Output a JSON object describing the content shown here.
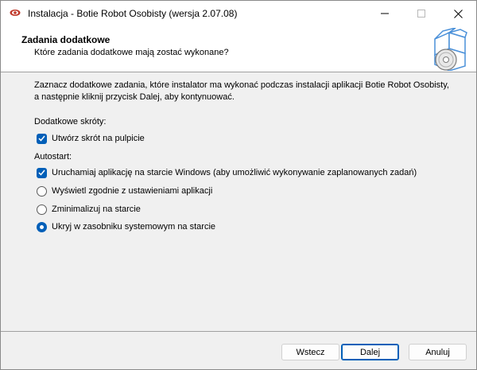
{
  "window": {
    "title": "Instalacja - Botie Robot Osobisty (wersja 2.07.08)"
  },
  "header": {
    "title": "Zadania dodatkowe",
    "subtitle": "Które zadania dodatkowe mają zostać wykonane?"
  },
  "content": {
    "description_line1": "Zaznacz dodatkowe zadania, które instalator ma wykonać podczas instalacji aplikacji Botie Robot Osobisty,",
    "description_line2": "a następnie kliknij przycisk Dalej, aby kontynuować.",
    "shortcuts_label": "Dodatkowe skróty:",
    "desktop_shortcut": {
      "label": "Utwórz skrót na pulpicie",
      "checked": true
    },
    "autostart_label": "Autostart:",
    "run_at_startup": {
      "label": "Uruchamiaj aplikację na starcie Windows (aby umożliwić wykonywanie zaplanowanych zadań)",
      "checked": true
    },
    "radio_options": [
      {
        "label": "Wyświetl zgodnie z ustawieniami aplikacji",
        "selected": false
      },
      {
        "label": "Zminimalizuj na starcie",
        "selected": false
      },
      {
        "label": "Ukryj w zasobniku systemowym na starcie",
        "selected": true
      }
    ]
  },
  "buttons": {
    "back": "Wstecz",
    "next": "Dalej",
    "cancel": "Anuluj"
  },
  "colors": {
    "accent": "#005fb8",
    "window_bg": "#f0f0f0",
    "header_bg": "#ffffff"
  },
  "icons": {
    "app": "app-eye-icon",
    "wizard": "box-cd-icon"
  }
}
